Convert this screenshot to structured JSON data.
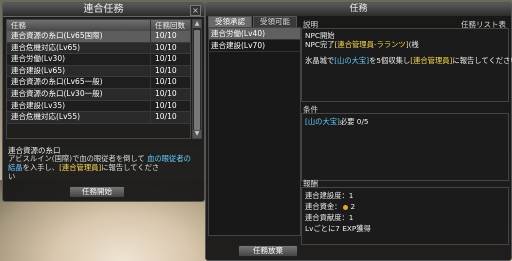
{
  "left": {
    "title": "連合任務",
    "close": "×",
    "col_task": "任務",
    "col_count": "任務回数",
    "rows": [
      {
        "name": "連合資源の糸口(Lv65国際)",
        "count": "10/10"
      },
      {
        "name": "連合危機対応(Lv65)",
        "count": "10/10"
      },
      {
        "name": "連合労働(Lv30)",
        "count": "10/10"
      },
      {
        "name": "連合建設(Lv65)",
        "count": "10/10"
      },
      {
        "name": "連合資源の糸口(Lv65一般)",
        "count": "10/10"
      },
      {
        "name": "連合資源の糸口(Lv30一般)",
        "count": "10/10"
      },
      {
        "name": "連合建設(Lv35)",
        "count": "10/10"
      },
      {
        "name": "連合危機対応(Lv55)",
        "count": "10/10"
      }
    ],
    "desc_title": "連合資源の糸口",
    "desc_1": "アビスルイン(国際)で血の眼従者を倒して",
    "desc_hl": "血の眼従者の結晶",
    "desc_2": "を入手し、",
    "desc_y": "[連合管理員]",
    "desc_3": "に報告してくださ",
    "desc_4": "い",
    "start_btn": "任務開始"
  },
  "right": {
    "title": "任務",
    "tab1": "受領承認",
    "tab2": "受領可能",
    "list": [
      "連合労働(Lv40)",
      "連合建設(Lv70)"
    ],
    "desc_label": "説明",
    "list_show": "任務リスト表示",
    "desc_npc_start": "NPC開始",
    "desc_npc_done_pre": "NPC完了",
    "desc_npc_done_y": "[連合管理員-ラランツ]",
    "desc_npc_done_post": "(桟",
    "desc_main_pre": "氷晶城で",
    "desc_main_hl": "[山の大宝]",
    "desc_main_mid": "を5個収集し",
    "desc_main_y": "[連合管理員]",
    "desc_main_post": "に報告してください",
    "cond_label": "条件",
    "cond_item": "[山の大宝]",
    "cond_rest": "必要 0/5",
    "reward_label": "報酬",
    "r1": "連合建設度：1",
    "r2_label": "連合資金：",
    "r2_val": "2",
    "r3": "連合貢献度：1",
    "r4": "Lvごとに7 EXP獲得",
    "abandon_btn": "任務放棄"
  }
}
